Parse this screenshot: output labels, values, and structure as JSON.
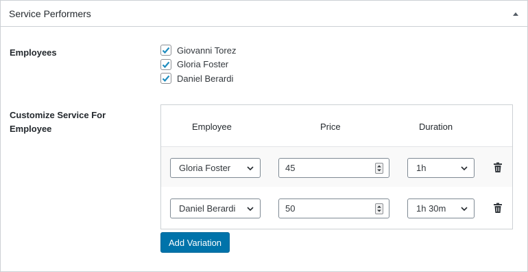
{
  "panel": {
    "title": "Service Performers",
    "toggle_icon": "triangle-up-icon"
  },
  "employees": {
    "label": "Employees",
    "items": [
      {
        "name": "Giovanni Torez",
        "checked": true
      },
      {
        "name": "Gloria Foster",
        "checked": true
      },
      {
        "name": "Daniel Berardi",
        "checked": true
      }
    ]
  },
  "customize": {
    "label": "Customize Service For Employee",
    "columns": {
      "employee": "Employee",
      "price": "Price",
      "duration": "Duration"
    },
    "rows": [
      {
        "employee": "Gloria Foster",
        "price": "45",
        "duration": "1h"
      },
      {
        "employee": "Daniel Berardi",
        "price": "50",
        "duration": "1h 30m"
      }
    ],
    "add_button": "Add Variation"
  },
  "colors": {
    "accent": "#0073aa",
    "border": "#ccd0d4",
    "text": "#23282d",
    "row_alt": "#f9f9f9"
  }
}
